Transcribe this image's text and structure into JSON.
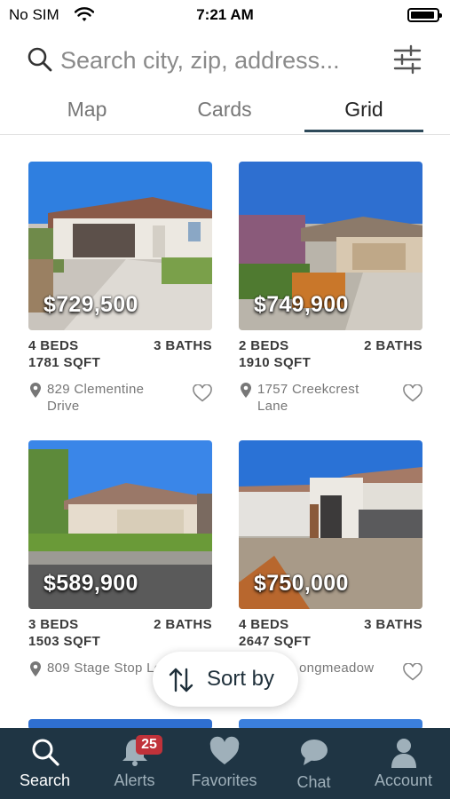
{
  "status_bar": {
    "carrier": "No SIM",
    "time": "7:21 AM"
  },
  "search": {
    "placeholder": "Search city, zip, address..."
  },
  "tabs": [
    {
      "label": "Map",
      "active": false
    },
    {
      "label": "Cards",
      "active": false
    },
    {
      "label": "Grid",
      "active": true
    }
  ],
  "listings": [
    {
      "price": "$729,500",
      "beds": "4 BEDS",
      "baths": "3 BATHS",
      "sqft": "1781 SQFT",
      "address": "829 Clementine Drive"
    },
    {
      "price": "$749,900",
      "beds": "2 BEDS",
      "baths": "2 BATHS",
      "sqft": "1910 SQFT",
      "address": "1757 Creekcrest Lane"
    },
    {
      "price": "$589,900",
      "beds": "3 BEDS",
      "baths": "2 BATHS",
      "sqft": "1503 SQFT",
      "address": "809 Stage Stop Loop"
    },
    {
      "price": "$750,000",
      "beds": "4 BEDS",
      "baths": "3 BATHS",
      "sqft": "2647 SQFT",
      "address": "ongmeadow"
    }
  ],
  "sort": {
    "label": "Sort by"
  },
  "bottom_nav": [
    {
      "label": "Search",
      "icon": "search-icon",
      "active": true
    },
    {
      "label": "Alerts",
      "icon": "bell-icon",
      "badge": "25"
    },
    {
      "label": "Favorites",
      "icon": "heart-icon"
    },
    {
      "label": "Chat",
      "icon": "chat-icon"
    },
    {
      "label": "Account",
      "icon": "person-icon"
    }
  ],
  "colors": {
    "nav_bg": "#1f3544",
    "accent": "#2e4a5a",
    "badge": "#c0323a"
  }
}
